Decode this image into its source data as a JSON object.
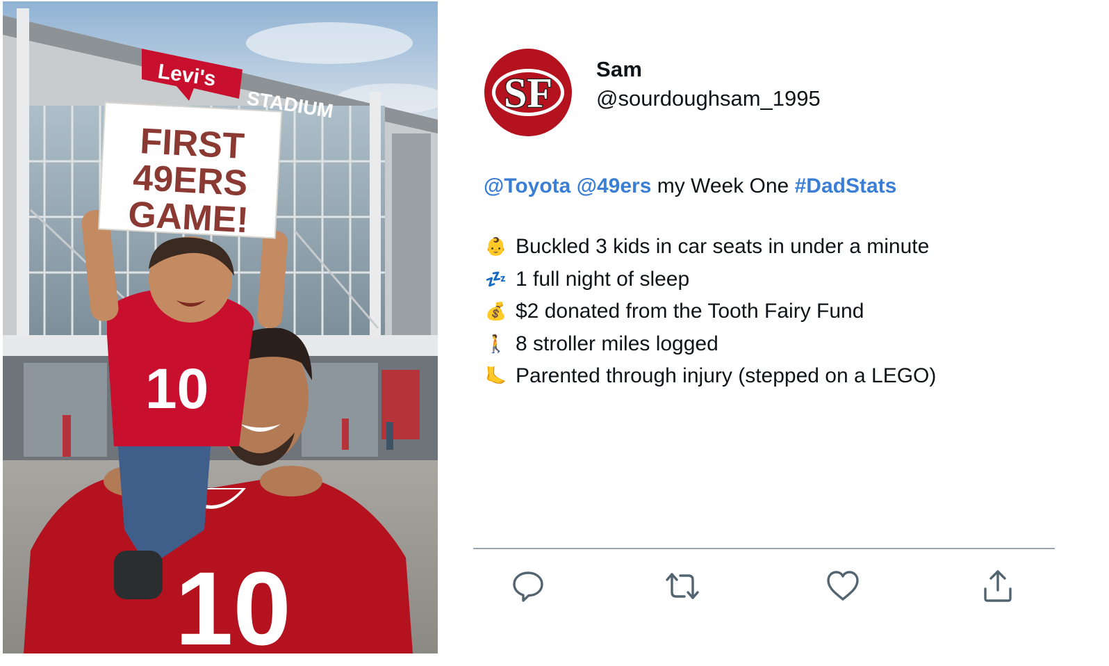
{
  "photo": {
    "stadium_logo": "Levi's",
    "stadium_name": "STADIUM",
    "sign_lines": [
      "FIRST",
      "49ERS",
      "GAME!"
    ],
    "jersey_number": "10"
  },
  "tweet": {
    "avatar_logo": "SF",
    "display_name": "Sam",
    "handle": "@sourdoughsam_1995",
    "mention_1": "@Toyota",
    "mention_2": "@49ers",
    "text_plain": "my Week One",
    "hashtag": "#DadStats",
    "stats": [
      {
        "emoji": "👶",
        "icon": "baby-icon",
        "text": "Buckled 3 kids in car seats in under a minute"
      },
      {
        "emoji": "💤",
        "icon": "sleep-zzz-icon",
        "text": "1 full night of sleep"
      },
      {
        "emoji": "💰",
        "icon": "money-bag-icon",
        "text": "$2 donated from the Tooth Fairy Fund"
      },
      {
        "emoji": "🚶",
        "icon": "walking-person-icon",
        "text": "8 stroller miles logged"
      },
      {
        "emoji": "🦶",
        "icon": "foot-icon",
        "text": "Parented through injury (stepped on a LEGO)"
      }
    ],
    "actions": [
      "reply-icon",
      "retweet-icon",
      "like-icon",
      "share-icon"
    ]
  },
  "colors": {
    "link": "#3b7ed6",
    "text": "#0f1419",
    "icon": "#536471",
    "niners_red": "#b3121e",
    "niners_gold": "#b3995d"
  }
}
